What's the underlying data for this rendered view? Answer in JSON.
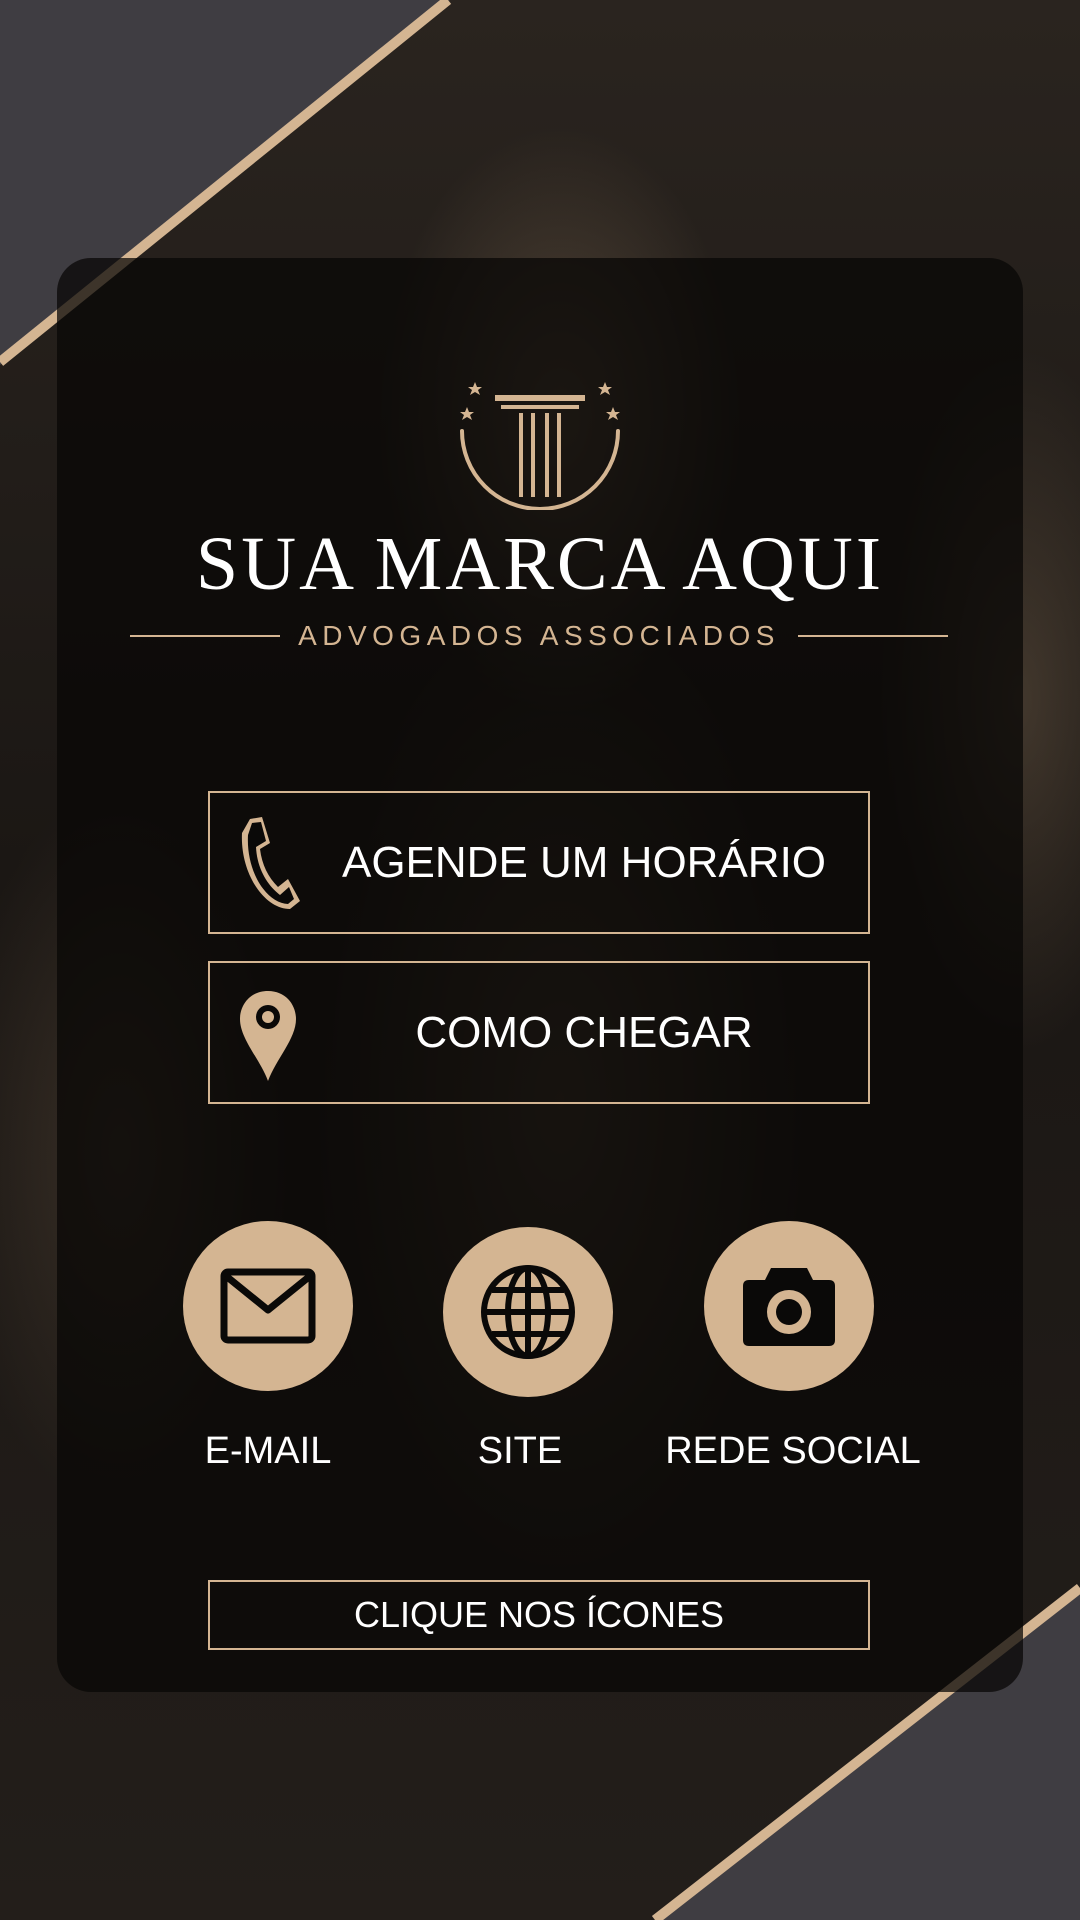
{
  "brand": {
    "name": "SUA MARCA AQUI",
    "tagline": "ADVOGADOS ASSOCIADOS",
    "logo_icon": "column-pillar-icon"
  },
  "buttons": [
    {
      "label": "AGENDE UM HORÁRIO",
      "icon": "phone-icon"
    },
    {
      "label": "COMO CHEGAR",
      "icon": "map-pin-icon"
    }
  ],
  "contacts": [
    {
      "label": "E-MAIL",
      "icon": "envelope-icon"
    },
    {
      "label": "SITE",
      "icon": "globe-icon"
    },
    {
      "label": "REDE SOCIAL",
      "icon": "camera-icon"
    }
  ],
  "cta": {
    "label": "CLIQUE NOS ÍCONES"
  },
  "colors": {
    "accent": "#d4b592",
    "background": "#14110f",
    "card": "#080706",
    "corner": "#3f3d42",
    "text": "#ffffff"
  }
}
